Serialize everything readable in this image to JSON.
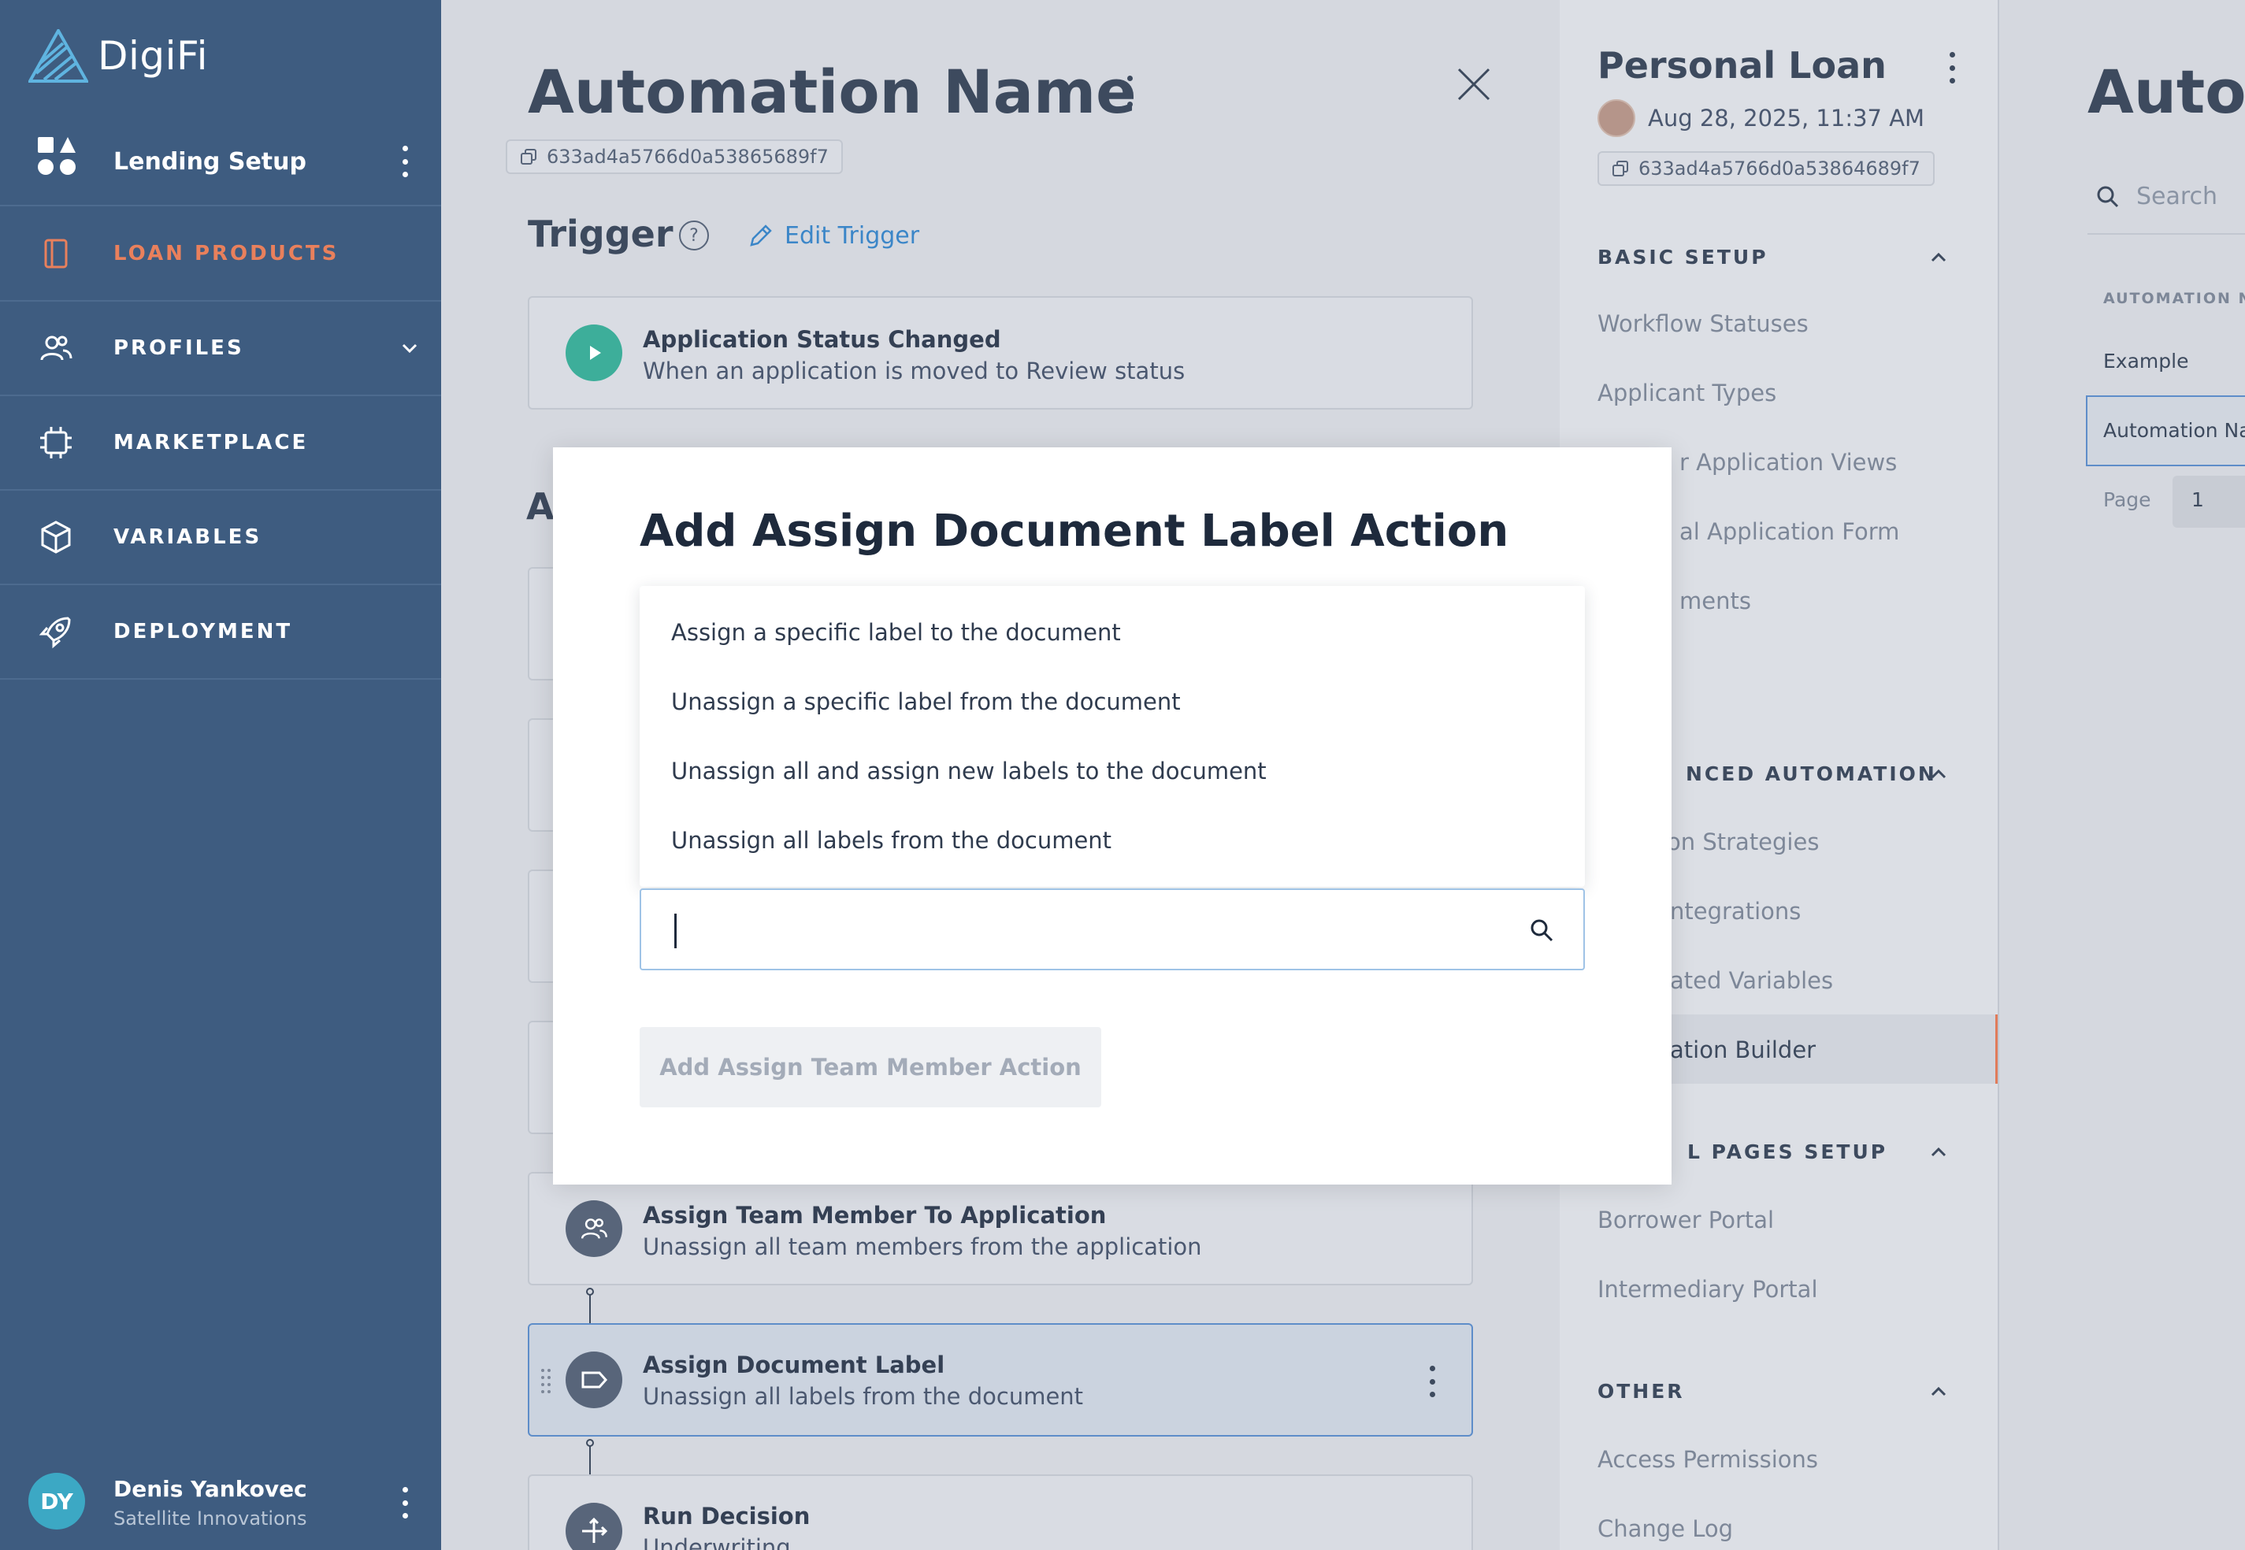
{
  "sidebar": {
    "logo_text": "DigiFi",
    "section_title": "Lending Setup",
    "nav": [
      {
        "label": "LOAN PRODUCTS"
      },
      {
        "label": "PROFILES"
      },
      {
        "label": "MARKETPLACE"
      },
      {
        "label": "VARIABLES"
      },
      {
        "label": "DEPLOYMENT"
      }
    ],
    "user": {
      "initials": "DY",
      "name": "Denis Yankovec",
      "org": "Satellite Innovations"
    }
  },
  "automation": {
    "title": "Automation Name",
    "id": "633ad4a5766d0a53865689f7",
    "trigger_heading": "Trigger",
    "help_glyph": "?",
    "edit_trigger_label": "Edit Trigger",
    "trigger_card": {
      "title": "Application Status Changed",
      "subtitle": "When an application is moved to Review status"
    },
    "actions_heading_partial": "A",
    "cards": [
      {
        "title": "Assign Team Member To Application",
        "subtitle": "Unassign all team members from the application"
      },
      {
        "title": "Assign Document Label",
        "subtitle": "Unassign all labels from the document"
      },
      {
        "title": "Run Decision",
        "subtitle": "Underwriting"
      }
    ]
  },
  "settings": {
    "title": "Personal Loan",
    "datetime": "Aug 28, 2025, 11:37 AM",
    "id": "633ad4a5766d0a53864689f7",
    "sections": [
      {
        "label": "BASIC SETUP",
        "items": [
          "Workflow Statuses",
          "Applicant Types",
          "r Application Views",
          "al Application Form",
          "ments"
        ]
      },
      {
        "label": "NCED AUTOMATION",
        "items": [
          "on Strategies",
          "ntegrations",
          "ated Variables",
          "ation Builder"
        ]
      },
      {
        "label": "L PAGES SETUP",
        "items": [
          "Borrower Portal",
          "Intermediary Portal"
        ]
      },
      {
        "label": "OTHER",
        "items": [
          "Access Permissions",
          "Change Log"
        ]
      }
    ]
  },
  "right_panel": {
    "title_partial": "Autor",
    "search_placeholder": "Search",
    "column_header": "AUTOMATION NA",
    "rows": [
      "Example",
      "Automation Na"
    ],
    "page_label": "Page",
    "page_value": "1"
  },
  "modal": {
    "title": "Add Assign Document Label Action",
    "options": [
      "Assign a specific label to the document",
      "Unassign a specific label from the document",
      "Unassign all and assign new labels to the document",
      "Unassign all labels from the document"
    ],
    "search_value": "",
    "submit_label": "Add Assign Team Member Action"
  },
  "colors": {
    "sidebar": "#3e5c80",
    "accent": "#e07b5a",
    "link": "#3b86c8",
    "trigger_green": "#3dae9a"
  }
}
